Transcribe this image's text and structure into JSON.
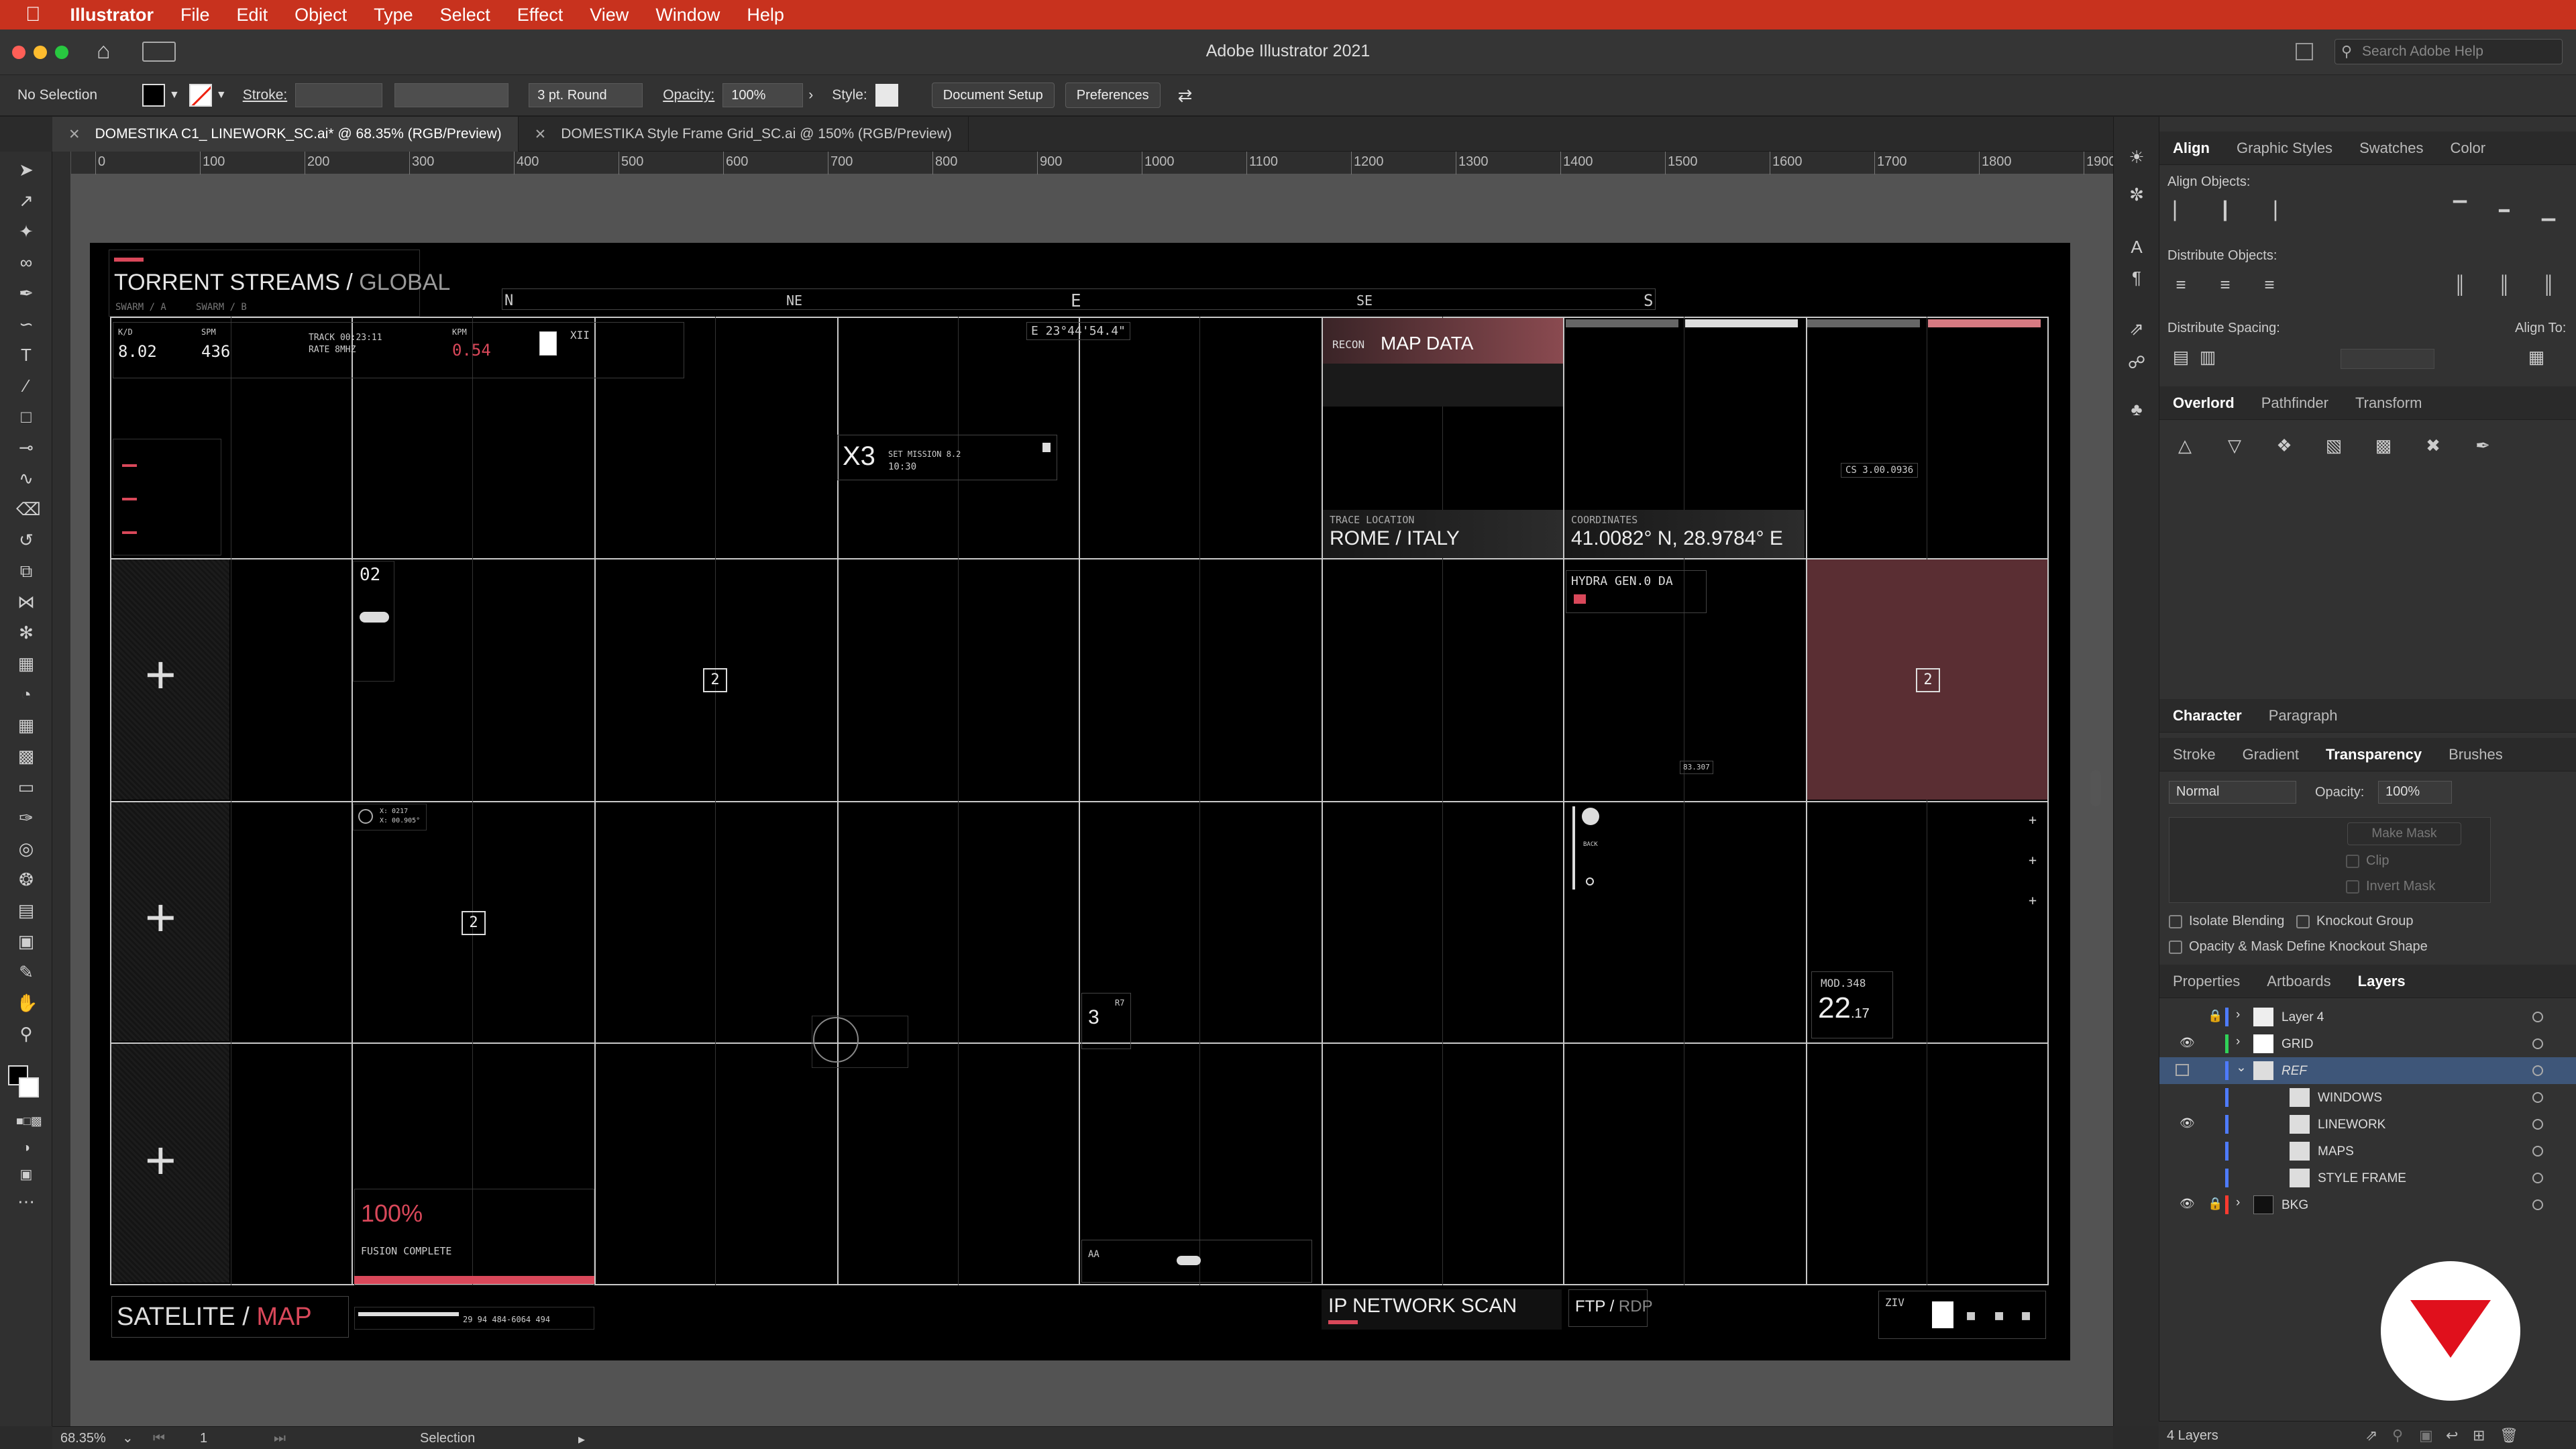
{
  "menubar": {
    "apple": "",
    "app_name": "Illustrator",
    "items": [
      "File",
      "Edit",
      "Object",
      "Type",
      "Select",
      "Effect",
      "View",
      "Window",
      "Help"
    ]
  },
  "titlebar": {
    "title": "Adobe Illustrator 2021",
    "search_placeholder": "Search Adobe Help"
  },
  "control": {
    "selection": "No Selection",
    "stroke_label": "Stroke:",
    "brush": "3 pt. Round",
    "opacity_label": "Opacity:",
    "opacity": "100%",
    "style_label": "Style:",
    "doc_setup": "Document Setup",
    "preferences": "Preferences"
  },
  "tabs": [
    {
      "label": "DOMESTIKA C1_ LINEWORK_SC.ai* @ 68.35% (RGB/Preview)",
      "active": true
    },
    {
      "label": "DOMESTIKA Style Frame Grid_SC.ai @ 150% (RGB/Preview)",
      "active": false
    }
  ],
  "ruler": {
    "h": [
      "0",
      "100",
      "200",
      "300",
      "400",
      "500",
      "600",
      "700",
      "800",
      "900",
      "1000",
      "1100",
      "1200",
      "1300",
      "1400",
      "1500",
      "1600",
      "1700",
      "1800",
      "1900"
    ]
  },
  "art": {
    "title_a": "TORRENT STREAMS /",
    "title_b": "GLOBAL",
    "sub_a": "SWARM / A",
    "sub_b": "SWARM / B",
    "compass": [
      "N",
      "NE",
      "E",
      "SE",
      "S"
    ],
    "kd_label": "K/D",
    "kd": "8.02",
    "spm_label": "SPM",
    "spm": "436",
    "track": "TRACK 00:23:11",
    "rate": "RATE 8MHZ",
    "kpm_label": "KPM",
    "kpm": "0.54",
    "xii": "XII",
    "coord_e": "E 23°44'54.4\"",
    "x3": "X3",
    "mission": "SET MISSION 8.2",
    "mission_time": "10:30",
    "recon": "RECON",
    "map_data": "MAP DATA",
    "trace_label": "TRACE LOCATION",
    "trace": "ROME / ITALY",
    "coords_label": "COORDINATES",
    "coords": "41.0082° N, 28.9784° E",
    "cs": "CS 3.00.0936",
    "n02": "02",
    "hydra": "HYDRA GEN.0 DA",
    "box2": "2",
    "mod": "MOD.348",
    "mod_val": "22",
    "mod_dec": ".17",
    "n3": "3",
    "r7": "R7",
    "pct": "100%",
    "fusion": "FUSION COMPLETE",
    "sat_a": "SATELITE /",
    "sat_b": "MAP",
    "ip": "IP NETWORK SCAN",
    "ftp_a": "FTP /",
    "ftp_b": "RDP",
    "ziv": "ZIV",
    "aa": "AA",
    "bar_vals": "29    94    484-6064    494",
    "x1": "X: 0217",
    "x2": "X: 00.905°",
    "rz": "83.307",
    "back": "BACK"
  },
  "right_panel": {
    "tabs1": [
      "Align",
      "Graphic Styles",
      "Swatches",
      "Color"
    ],
    "align_objects": "Align Objects:",
    "distribute_objects": "Distribute Objects:",
    "distribute_spacing": "Distribute Spacing:",
    "align_to": "Align To:",
    "tabs2": [
      "Overlord",
      "Pathfinder",
      "Transform"
    ],
    "tabs3": [
      "Character",
      "Paragraph"
    ],
    "tabs4": [
      "Stroke",
      "Gradient",
      "Transparency",
      "Brushes"
    ],
    "blend_mode": "Normal",
    "opacity_label": "Opacity:",
    "opacity": "100%",
    "make_mask": "Make Mask",
    "clip": "Clip",
    "invert_mask": "Invert Mask",
    "isolate": "Isolate Blending",
    "knockout": "Knockout Group",
    "opacity_mask": "Opacity & Mask Define Knockout Shape",
    "tabs5": [
      "Properties",
      "Artboards",
      "Layers"
    ],
    "layers": [
      {
        "name": "Layer 4",
        "color": "#4e7bff"
      },
      {
        "name": "GRID",
        "color": "#30d158"
      },
      {
        "name": "REF",
        "color": "#4e7bff"
      },
      {
        "name": "WINDOWS",
        "color": "#4e7bff"
      },
      {
        "name": "LINEWORK",
        "color": "#4e7bff"
      },
      {
        "name": "MAPS",
        "color": "#4e7bff"
      },
      {
        "name": "STYLE FRAME",
        "color": "#4e7bff"
      },
      {
        "name": "BKG",
        "color": "#ff3b30"
      }
    ],
    "layers_count": "4 Layers"
  },
  "status": {
    "zoom": "68.35%",
    "page": "1",
    "tool": "Selection"
  },
  "colors": {
    "menubar": "#c8321e",
    "accent_red": "#d9485a",
    "artboard": "#000000",
    "canvas": "#535353"
  }
}
